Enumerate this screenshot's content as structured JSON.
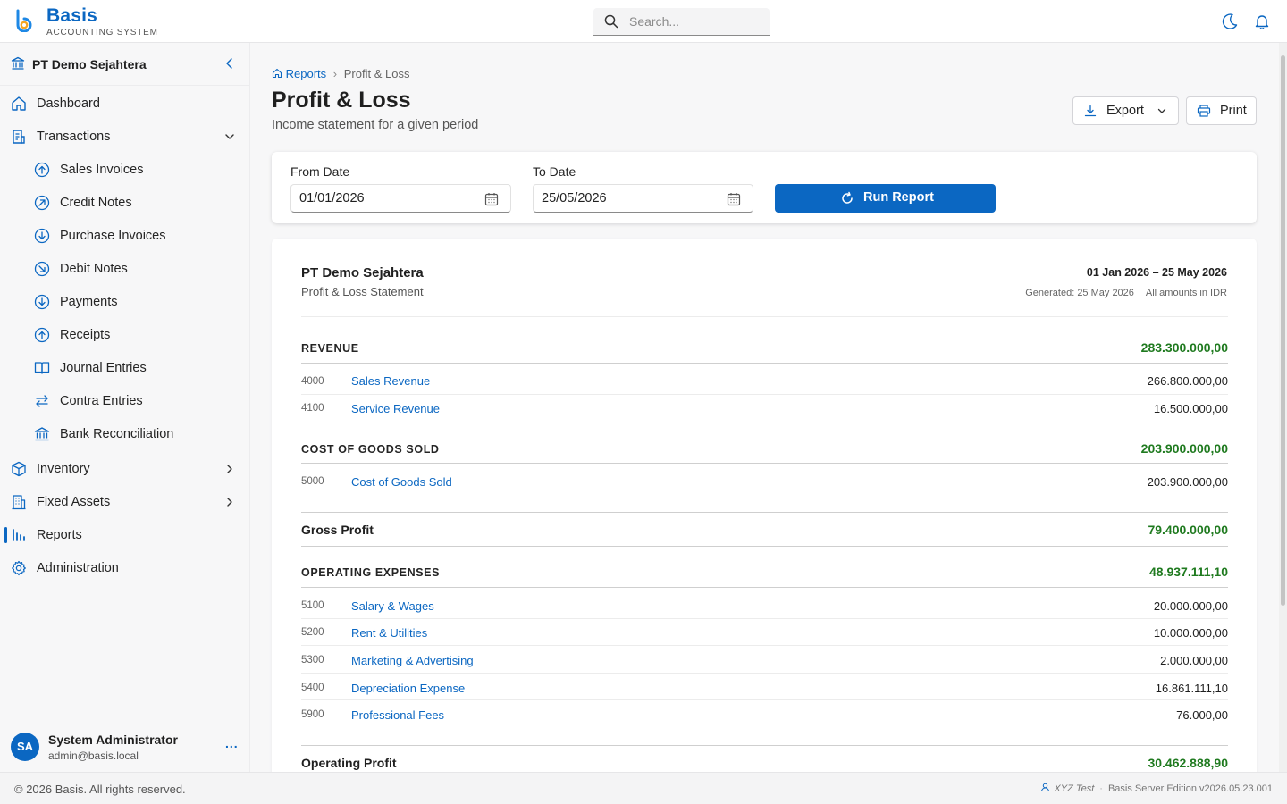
{
  "app": {
    "brand": "Basis",
    "brand_sub": "ACCOUNTING SYSTEM",
    "search_placeholder": "Search..."
  },
  "sidebar": {
    "org_name": "PT Demo Sejahtera",
    "items": [
      {
        "label": "Dashboard"
      },
      {
        "label": "Transactions"
      },
      {
        "label": "Sales Invoices"
      },
      {
        "label": "Credit Notes"
      },
      {
        "label": "Purchase Invoices"
      },
      {
        "label": "Debit Notes"
      },
      {
        "label": "Payments"
      },
      {
        "label": "Receipts"
      },
      {
        "label": "Journal Entries"
      },
      {
        "label": "Contra Entries"
      },
      {
        "label": "Bank Reconciliation"
      },
      {
        "label": "Inventory"
      },
      {
        "label": "Fixed Assets"
      },
      {
        "label": "Reports"
      },
      {
        "label": "Administration"
      }
    ],
    "user": {
      "initials": "SA",
      "name": "System Administrator",
      "email": "admin@basis.local",
      "more": "..."
    }
  },
  "page": {
    "breadcrumb_home": "Reports",
    "breadcrumb_sep": "›",
    "breadcrumb_current": "Profit & Loss",
    "title": "Profit & Loss",
    "subtitle": "Income statement for a given period",
    "export_label": "Export",
    "print_label": "Print"
  },
  "filters": {
    "from_label": "From Date",
    "from_value": "01/01/2026",
    "to_label": "To Date",
    "to_value": "25/05/2026",
    "run_label": "Run Report"
  },
  "report": {
    "company": "PT Demo Sejahtera",
    "statement": "Profit & Loss Statement",
    "period": "01 Jan 2026 – 25 May 2026",
    "generated": "Generated: 25 May 2026",
    "amounts_note": "All amounts in IDR",
    "revenue": {
      "title": "REVENUE",
      "total": "283.300.000,00",
      "rows": [
        {
          "code": "4000",
          "name": "Sales Revenue",
          "amount": "266.800.000,00"
        },
        {
          "code": "4100",
          "name": "Service Revenue",
          "amount": "16.500.000,00"
        }
      ]
    },
    "cogs": {
      "title": "COST OF GOODS SOLD",
      "total": "203.900.000,00",
      "rows": [
        {
          "code": "5000",
          "name": "Cost of Goods Sold",
          "amount": "203.900.000,00"
        }
      ]
    },
    "gross_profit": {
      "label": "Gross Profit",
      "amount": "79.400.000,00"
    },
    "opex": {
      "title": "OPERATING EXPENSES",
      "total": "48.937.111,10",
      "rows": [
        {
          "code": "5100",
          "name": "Salary & Wages",
          "amount": "20.000.000,00"
        },
        {
          "code": "5200",
          "name": "Rent & Utilities",
          "amount": "10.000.000,00"
        },
        {
          "code": "5300",
          "name": "Marketing & Advertising",
          "amount": "2.000.000,00"
        },
        {
          "code": "5400",
          "name": "Depreciation Expense",
          "amount": "16.861.111,10"
        },
        {
          "code": "5900",
          "name": "Professional Fees",
          "amount": "76.000,00"
        }
      ]
    },
    "operating_profit": {
      "label": "Operating Profit",
      "amount": "30.462.888,90"
    }
  },
  "footer": {
    "copyright": "© 2026 Basis. All rights reserved.",
    "env": "XYZ Test",
    "sep": "·",
    "edition": "Basis Server Edition v2026.05.23.001"
  },
  "colors": {
    "accent": "#0b67c2",
    "positive": "#1f7a1f"
  }
}
